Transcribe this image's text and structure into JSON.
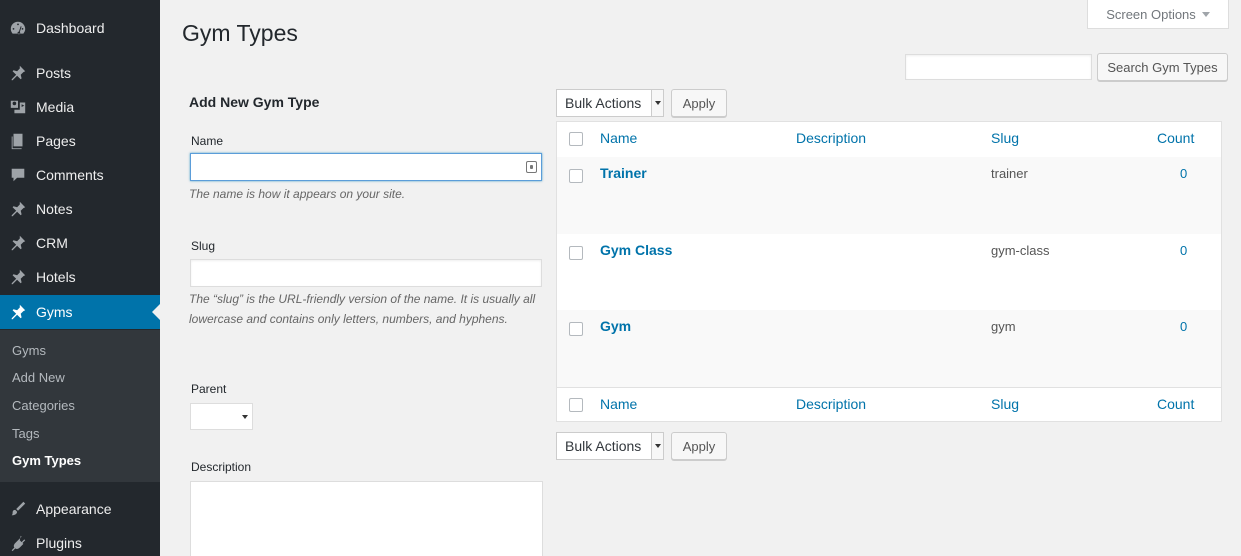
{
  "sidebar": {
    "items": [
      {
        "label": "Dashboard",
        "icon": "dashboard-icon"
      },
      {
        "label": "Posts",
        "icon": "pin-icon"
      },
      {
        "label": "Media",
        "icon": "media-icon"
      },
      {
        "label": "Pages",
        "icon": "pages-icon"
      },
      {
        "label": "Comments",
        "icon": "comment-icon"
      },
      {
        "label": "Notes",
        "icon": "pin-icon"
      },
      {
        "label": "CRM",
        "icon": "pin-icon"
      },
      {
        "label": "Hotels",
        "icon": "pin-icon"
      },
      {
        "label": "Gyms",
        "icon": "pin-icon"
      },
      {
        "label": "Appearance",
        "icon": "paintbrush-icon"
      },
      {
        "label": "Plugins",
        "icon": "plugin-icon"
      }
    ],
    "submenu": [
      "Gyms",
      "Add New",
      "Categories",
      "Tags",
      "Gym Types"
    ]
  },
  "header": {
    "title": "Gym Types",
    "screen_options": "Screen Options",
    "search_button": "Search Gym Types",
    "search_value": ""
  },
  "form": {
    "heading": "Add New Gym Type",
    "name_label": "Name",
    "name_help": "The name is how it appears on your site.",
    "slug_label": "Slug",
    "slug_help": "The “slug” is the URL-friendly version of the name. It is usually all lowercase and contains only letters, numbers, and hyphens.",
    "parent_label": "Parent",
    "description_label": "Description"
  },
  "bulk": {
    "select_label": "Bulk Actions",
    "apply_label": "Apply"
  },
  "table": {
    "columns": {
      "name": "Name",
      "description": "Description",
      "slug": "Slug",
      "count": "Count"
    },
    "rows": [
      {
        "name": "Trainer",
        "slug": "trainer",
        "count": "0"
      },
      {
        "name": "Gym Class",
        "slug": "gym-class",
        "count": "0"
      },
      {
        "name": "Gym",
        "slug": "gym",
        "count": "0"
      }
    ]
  },
  "colors": {
    "sidebar_bg": "#23282d",
    "active": "#0073aa",
    "link": "#0073aa"
  }
}
